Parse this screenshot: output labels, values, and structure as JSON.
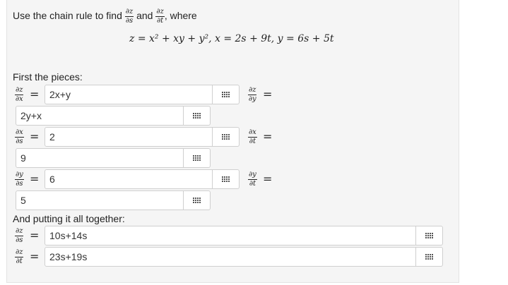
{
  "prompt": {
    "text_before": "Use the chain rule to find",
    "and": "and",
    "where": ", where",
    "frac1": {
      "num": "∂z",
      "den": "∂s"
    },
    "frac2": {
      "num": "∂z",
      "den": "∂t"
    }
  },
  "equation": "z = x² + xy + y², x = 2s + 9t, y = 6s + 5t",
  "pieces_heading": "First the pieces:",
  "together_heading": "And putting it all together:",
  "equals": "=",
  "rows": [
    {
      "left": {
        "num": "∂z",
        "den": "∂x"
      },
      "value_left": "2x+y",
      "right": {
        "num": "∂z",
        "den": "∂y"
      },
      "value_right": "2y+x"
    },
    {
      "left": {
        "num": "∂x",
        "den": "∂s"
      },
      "value_left": "2",
      "right": {
        "num": "∂x",
        "den": "∂t"
      },
      "value_right": "9"
    },
    {
      "left": {
        "num": "∂y",
        "den": "∂s"
      },
      "value_left": "6",
      "right": {
        "num": "∂y",
        "den": "∂t"
      },
      "value_right": "5"
    }
  ],
  "final": [
    {
      "label": {
        "num": "∂z",
        "den": "∂s"
      },
      "value": "10s+14s"
    },
    {
      "label": {
        "num": "∂z",
        "den": "∂t"
      },
      "value": "23s+19s"
    }
  ],
  "icon": "keyboard-grid-icon"
}
